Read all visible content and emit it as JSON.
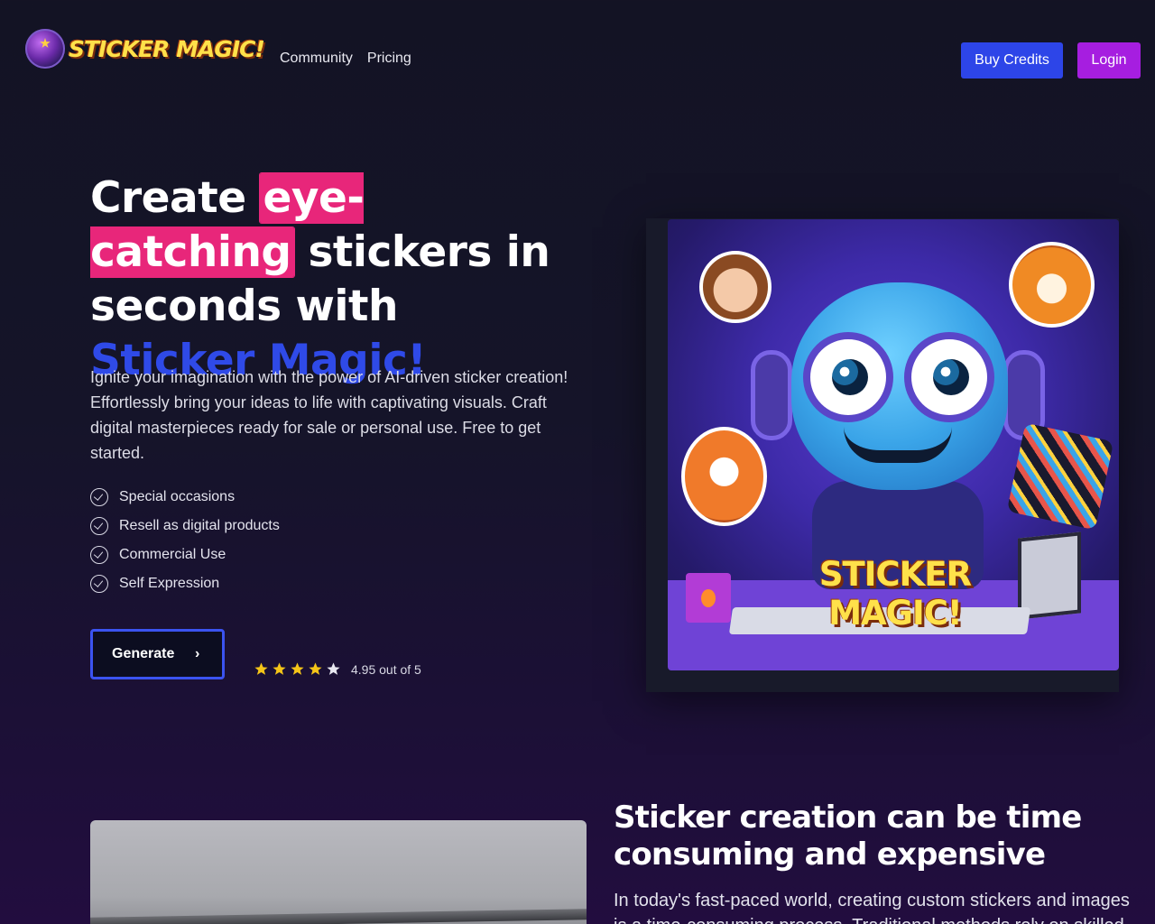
{
  "brand": {
    "logo_text": "STICKER MAGIC!",
    "logo_icon": "wizard-orb-icon"
  },
  "nav": {
    "items": [
      {
        "label": "Community"
      },
      {
        "label": "Pricing"
      }
    ]
  },
  "header_buttons": {
    "buy_credits": "Buy Credits",
    "login": "Login"
  },
  "hero": {
    "title_part1": "Create ",
    "title_highlight": "eye-catching",
    "title_part2": " stickers in seconds with ",
    "title_brand": "Sticker Magic!",
    "description": "Ignite your imagination with the power of AI-driven sticker creation! Effortlessly bring your ideas to life with captivating visuals. Craft digital masterpieces ready for sale or personal use. Free to get started.",
    "features": [
      {
        "label": "Special occasions"
      },
      {
        "label": "Resell as digital products"
      },
      {
        "label": "Commercial Use"
      },
      {
        "label": "Self Expression"
      }
    ],
    "cta_label": "Generate",
    "cta_icon": "chevron-right-icon",
    "rating": {
      "stars_filled": 4,
      "stars_total": 5,
      "text": "4.95 out of 5"
    },
    "image_brand_text": "STICKER MAGIC!"
  },
  "section2": {
    "title": "Sticker creation can be time consuming and expensive",
    "text": "In today's fast-paced world, creating custom stickers and images is a time-consuming process. Traditional methods rely on skilled"
  },
  "colors": {
    "accent_blue": "#2d45e8",
    "accent_purple": "#a61ee0",
    "highlight_pink": "#e8267a",
    "star_yellow": "#f5c518",
    "background": "#131324"
  }
}
